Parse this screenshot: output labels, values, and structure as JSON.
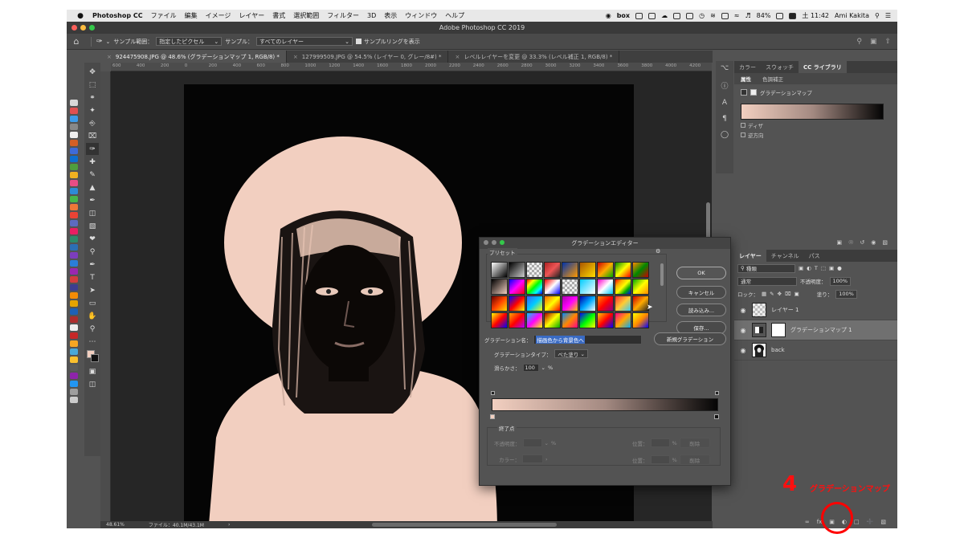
{
  "menubar": {
    "app": "Photoshop CC",
    "items": [
      "ファイル",
      "編集",
      "イメージ",
      "レイヤー",
      "書式",
      "選択範囲",
      "フィルター",
      "3D",
      "表示",
      "ウィンドウ",
      "ヘルプ"
    ],
    "tray_box": "box",
    "battery": "84%",
    "time": "土 11:42",
    "user": "Ami Kakita"
  },
  "window": {
    "title": "Adobe Photoshop CC 2019",
    "colors": {
      "close": "#fc605b",
      "minimize": "#fdbc40",
      "zoom": "#34c84a"
    }
  },
  "options": {
    "sample_range_label": "サンプル範囲：",
    "sample_range_value": "指定したピクセル",
    "sample_label": "サンプル：",
    "sample_value": "すべてのレイヤー",
    "sampling_ring": "サンプルリングを表示"
  },
  "tabs": [
    {
      "label": "924475908.JPG @ 48.6% (グラデーションマップ 1, RGB/8) *",
      "active": true
    },
    {
      "label": "127999509.JPG @ 54.5% (レイヤー 0, グレー/8#) *",
      "active": false
    },
    {
      "label": "レベルレイヤーを変更 @ 33.3% (レベル補正 1, RGB/8) *",
      "active": false
    }
  ],
  "ruler": [
    "600",
    "400",
    "200",
    "0",
    "200",
    "400",
    "600",
    "800",
    "1000",
    "1200",
    "1400",
    "1600",
    "1800",
    "2000",
    "2200",
    "2400",
    "2600",
    "2800",
    "3000",
    "3200",
    "3400",
    "3600",
    "3800",
    "4000",
    "4200"
  ],
  "status": {
    "zoom": "48.61%",
    "file": "ファイル：40.1M/43.1M"
  },
  "right_panel": {
    "top_tabs": [
      "カラー",
      "スウォッチ",
      "CC ライブラリ"
    ],
    "props_tabs": [
      "属性",
      "色調補正"
    ],
    "props_title": "グラデーションマップ",
    "dither": "ディザ",
    "reverse": "逆方向"
  },
  "layers": {
    "tabs": [
      "レイヤー",
      "チャンネル",
      "パス"
    ],
    "filter": "種類",
    "blend": "通常",
    "opacity_label": "不透明度：",
    "opacity": "100%",
    "lock_label": "ロック：",
    "fill_label": "塗り：",
    "fill": "100%",
    "items": [
      {
        "name": "レイヤー 1",
        "thumb": "transparent",
        "active": false
      },
      {
        "name": "グラデーションマップ 1",
        "thumb": "adjustment",
        "active": true
      },
      {
        "name": "back",
        "thumb": "photo",
        "active": false
      }
    ]
  },
  "dialog": {
    "title": "グラデーションエディター",
    "presets_label": "プリセット",
    "buttons": {
      "ok": "OK",
      "cancel": "キャンセル",
      "load": "読み込み...",
      "save": "保存..."
    },
    "name_label": "グラデーション名：",
    "name_value": "描画色から背景色へ",
    "new_button": "新規グラデーション",
    "type_label": "グラデーションタイプ：",
    "type_value": "べた塗り",
    "smooth_label": "滑らかさ：",
    "smooth_value": "100",
    "smooth_unit": "%",
    "stops_label": "終了点",
    "opacity_label": "不透明度：",
    "color_label": "カラー：",
    "position_label": "位置：",
    "delete_label": "削除",
    "percent": "%",
    "gradient_colors": [
      "#f2cfc0",
      "#a48a82",
      "#050505"
    ]
  },
  "annotation": {
    "number": "4",
    "text": "グラデーションマップ",
    "color": "#ff0f0f"
  }
}
